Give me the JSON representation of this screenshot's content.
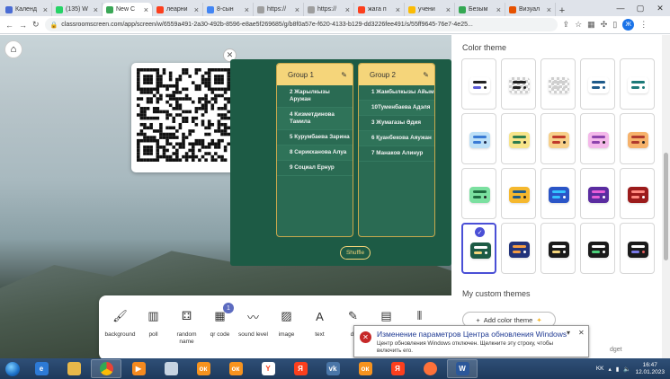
{
  "tabs": [
    {
      "label": "Календ",
      "color": "#4a6cd4"
    },
    {
      "label": "(135) W",
      "color": "#25d366"
    },
    {
      "label": "New C",
      "color": "#3aa757",
      "active": true
    },
    {
      "label": "леарни",
      "color": "#fc3f1d"
    },
    {
      "label": "8-сын",
      "color": "#4285f4"
    },
    {
      "label": "https://",
      "color": "#9e9e9e"
    },
    {
      "label": "https://",
      "color": "#9e9e9e"
    },
    {
      "label": "жага п",
      "color": "#fc3f1d"
    },
    {
      "label": "учени",
      "color": "#fbbc05"
    },
    {
      "label": "Безым",
      "color": "#34a853"
    },
    {
      "label": "Визуал",
      "color": "#e65100"
    }
  ],
  "address": {
    "url": "classroomscreen.com/app/screen/w/6559a491-2a30-492b-8596-e8ae5f269685/g/b8f0a57e-f620-4133-b129-dd3226fee491/s/55ff9645-76e7-4e25..."
  },
  "profile_initial": "Ж",
  "groups": [
    {
      "name": "Group 1",
      "members": [
        "2 Жарылкызы Аружан",
        "4 Кизметдинова Тамила",
        "5 Курумбаева Зарина",
        "8 Серикханова Алуа",
        "9 Социал Ернур"
      ]
    },
    {
      "name": "Group 2",
      "members": [
        "1 Жамбылкызы Айым",
        "10Туменбаева Адэля",
        "3 Жумагазы Әдия",
        "6 Қуанбекова Аяужан",
        "7 Манаков Алинур"
      ]
    }
  ],
  "shuffle_label": "Shuffle",
  "tools": [
    {
      "label": "background",
      "icon": "background-icon"
    },
    {
      "label": "poll",
      "icon": "poll-icon"
    },
    {
      "label": "random name",
      "icon": "random-name-icon"
    },
    {
      "label": "qr code",
      "icon": "qr-code-icon"
    },
    {
      "label": "sound level",
      "icon": "sound-level-icon"
    },
    {
      "label": "image",
      "icon": "image-icon"
    },
    {
      "label": "text",
      "icon": "text-icon"
    },
    {
      "label": "dr",
      "icon": "draw-icon"
    },
    {
      "label": "",
      "icon": "work-symbols-icon"
    },
    {
      "label": "",
      "icon": "traffic-light-icon"
    }
  ],
  "qr_badge": "1",
  "color_theme_title": "Color theme",
  "themes": [
    {
      "bg": "#ffffff",
      "bar": "#222222",
      "line": "#5b5bd6",
      "dot": "#222222"
    },
    {
      "bg": "#d9d9d9",
      "bar": "#222222",
      "line": "#222222",
      "dot": "#222222",
      "pattern": true
    },
    {
      "bg": "#ececec",
      "bar": "#cfcfcf",
      "line": "#cfcfcf",
      "dot": "#cfcfcf",
      "pattern": true
    },
    {
      "bg": "#ffffff",
      "bar": "#1e5a8a",
      "line": "#1e5a8a",
      "dot": "#1e5a8a"
    },
    {
      "bg": "#ffffff",
      "bar": "#1d7a78",
      "line": "#1d7a78",
      "dot": "#1d7a78"
    },
    {
      "bg": "#bde0f7",
      "bar": "#3a7bd5",
      "line": "#3a7bd5",
      "dot": "#1e2a4a"
    },
    {
      "bg": "#f7e48a",
      "bar": "#2e7d4f",
      "line": "#2e7d4f",
      "dot": "#222222"
    },
    {
      "bg": "#f7d08a",
      "bar": "#c0392b",
      "line": "#c0392b",
      "dot": "#222222"
    },
    {
      "bg": "#f4b8ea",
      "bar": "#8e44ad",
      "line": "#8e44ad",
      "dot": "#222222"
    },
    {
      "bg": "#f6b26b",
      "bar": "#b03a2e",
      "line": "#b03a2e",
      "dot": "#222222"
    },
    {
      "bg": "#7be0a0",
      "bar": "#1e6b3f",
      "line": "#1e6b3f",
      "dot": "#222222"
    },
    {
      "bg": "#f5b82e",
      "bar": "#1e5a8a",
      "line": "#1e5a8a",
      "dot": "#222222"
    },
    {
      "bg": "#2a55c7",
      "bar": "#34c3ff",
      "line": "#34c3ff",
      "dot": "#ffffff"
    },
    {
      "bg": "#5a2ca0",
      "bar": "#e85dd8",
      "line": "#e85dd8",
      "dot": "#ffffff"
    },
    {
      "bg": "#9b1b1b",
      "bar": "#ff8a80",
      "line": "#ff8a80",
      "dot": "#ffffff"
    },
    {
      "bg": "#1d5b45",
      "bar": "#ffffff",
      "line": "#f5d57a",
      "dot": "#ffffff",
      "selected": true
    },
    {
      "bg": "#22337a",
      "bar": "#f59d42",
      "line": "#f59d42",
      "dot": "#ffffff"
    },
    {
      "bg": "#1a1a1a",
      "bar": "#ffffff",
      "line": "#f5d57a",
      "dot": "#ffffff"
    },
    {
      "bg": "#1a1a1a",
      "bar": "#ffffff",
      "line": "#4cd07a",
      "dot": "#ffffff"
    },
    {
      "bg": "#1a1a1a",
      "bar": "#ffffff",
      "line": "#7a7ae8",
      "dot": "#e85d5d"
    }
  ],
  "my_custom_title": "My custom themes",
  "add_color_label": "Add color theme",
  "budget_fragment": "dget",
  "toast": {
    "title": "Изменение параметров Центра обновления Windows",
    "text": "Центр обновления Windows отключен. Щелкните эту строку, чтобы включить его."
  },
  "taskbar_apps": [
    {
      "name": "ie",
      "label": "e",
      "color": "#2d7ad6"
    },
    {
      "name": "explorer",
      "label": "",
      "color": "#e8b84a"
    },
    {
      "name": "chrome",
      "label": "",
      "color": "#e84c3d",
      "open": true
    },
    {
      "name": "media",
      "label": "▶",
      "color": "#f58a1f"
    },
    {
      "name": "window",
      "label": "",
      "color": "#c7d4e2"
    },
    {
      "name": "ok",
      "label": "ок",
      "color": "#f7931e"
    },
    {
      "name": "ok2",
      "label": "ок",
      "color": "#f7931e"
    },
    {
      "name": "yandex",
      "label": "Y",
      "color": "#ffffff"
    },
    {
      "name": "ya",
      "label": "Я",
      "color": "#fc3f1d"
    },
    {
      "name": "vk",
      "label": "vk",
      "color": "#4a76a8"
    },
    {
      "name": "ok3",
      "label": "ок",
      "color": "#f7931e"
    },
    {
      "name": "ya2",
      "label": "Я",
      "color": "#fc3f1d"
    },
    {
      "name": "firefox",
      "label": "",
      "color": "#ff7139"
    },
    {
      "name": "word",
      "label": "W",
      "color": "#2b579a",
      "open": true
    }
  ],
  "tray": {
    "lang": "KK",
    "time": "16:47",
    "date": "12.01.2023"
  }
}
